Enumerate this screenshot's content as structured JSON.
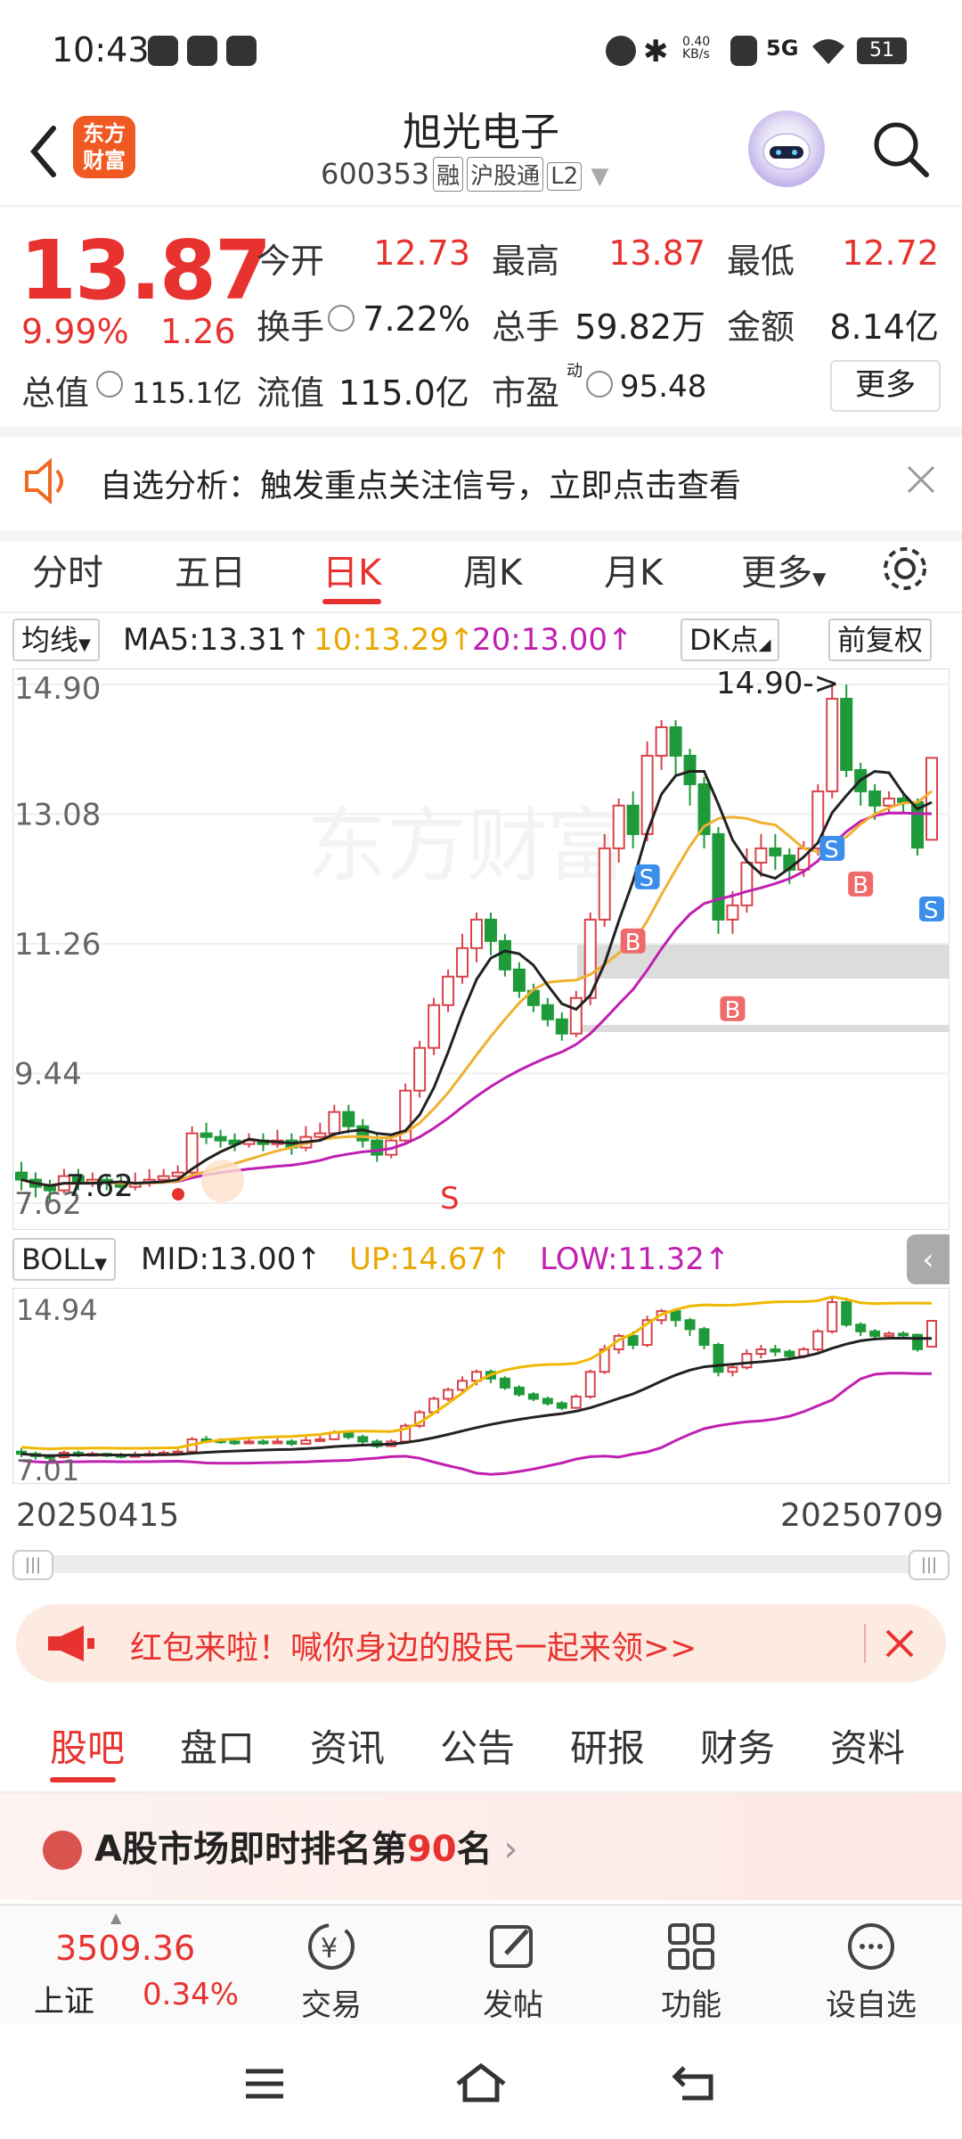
{
  "status_bar": {
    "time": "10:43",
    "speed": "0.40\nKB/s",
    "battery": "51"
  },
  "header": {
    "logo_text": "东方财富",
    "stock_name": "旭光电子",
    "stock_code": "600353",
    "tags": [
      "融",
      "沪股通",
      "L2"
    ]
  },
  "quote": {
    "price": "13.87",
    "change_pct": "9.99%",
    "change": "1.26",
    "stats": [
      {
        "label": "今开",
        "value": "12.73",
        "color": "#e8322f"
      },
      {
        "label": "最高",
        "value": "13.87",
        "color": "#e8322f"
      },
      {
        "label": "最低",
        "value": "12.72",
        "color": "#e8322f"
      },
      {
        "label": "换手",
        "value": "7.22%",
        "color": "#222222"
      },
      {
        "label": "总手",
        "value": "59.82万",
        "color": "#222222"
      },
      {
        "label": "金额",
        "value": "8.14亿",
        "color": "#222222"
      }
    ],
    "total_value_label": "总值",
    "total_value": "115.1亿",
    "float_value_label": "流值",
    "float_value": "115.0亿",
    "pe_label": "市盈",
    "pe_superscript": "动",
    "pe_value": "95.48",
    "more_label": "更多"
  },
  "alert": {
    "text": "自选分析：触发重点关注信号，立即点击查看"
  },
  "chart_tabs": {
    "items": [
      "分时",
      "五日",
      "日K",
      "周K",
      "月K",
      "更多"
    ],
    "active": "日K"
  },
  "indicator_bar": {
    "selector": "均线",
    "ma5": "MA5:13.31↑",
    "ma10": "10:13.29↑",
    "ma20": "20:13.00↑",
    "dk_label": "DK点",
    "adjust_label": "前复权"
  },
  "chart_data": [
    {
      "type": "candlestick",
      "y_ticks": [
        "14.90",
        "13.08",
        "11.26",
        "9.44",
        "7.62"
      ],
      "ylim": [
        7.62,
        14.9
      ],
      "max_marker": "14.90->",
      "min_marker": "7.62",
      "signal_markers": [
        "S",
        "B",
        "B",
        "S",
        "B",
        "S"
      ],
      "s_label_bottom": "S",
      "candles": [
        [
          8.05,
          7.95,
          8.2,
          7.8
        ],
        [
          7.95,
          7.85,
          8.05,
          7.7
        ],
        [
          7.85,
          7.8,
          7.95,
          7.62
        ],
        [
          7.8,
          8.0,
          8.1,
          7.75
        ],
        [
          8.0,
          7.9,
          8.1,
          7.8
        ],
        [
          7.9,
          7.95,
          8.05,
          7.85
        ],
        [
          7.95,
          7.9,
          8.0,
          7.8
        ],
        [
          7.9,
          7.85,
          8.0,
          7.75
        ],
        [
          7.85,
          7.9,
          8.05,
          7.8
        ],
        [
          7.9,
          7.95,
          8.1,
          7.85
        ],
        [
          7.95,
          8.0,
          8.1,
          7.9
        ],
        [
          8.0,
          8.05,
          8.15,
          7.95
        ],
        [
          8.05,
          8.6,
          8.7,
          8.0
        ],
        [
          8.6,
          8.55,
          8.75,
          8.45
        ],
        [
          8.55,
          8.5,
          8.65,
          8.4
        ],
        [
          8.5,
          8.45,
          8.6,
          8.35
        ],
        [
          8.45,
          8.5,
          8.6,
          8.4
        ],
        [
          8.5,
          8.45,
          8.6,
          8.35
        ],
        [
          8.45,
          8.5,
          8.65,
          8.4
        ],
        [
          8.5,
          8.4,
          8.6,
          8.3
        ],
        [
          8.4,
          8.55,
          8.7,
          8.35
        ],
        [
          8.55,
          8.6,
          8.75,
          8.5
        ],
        [
          8.6,
          8.9,
          9.0,
          8.55
        ],
        [
          8.9,
          8.7,
          9.0,
          8.6
        ],
        [
          8.7,
          8.5,
          8.8,
          8.4
        ],
        [
          8.5,
          8.3,
          8.6,
          8.2
        ],
        [
          8.3,
          8.5,
          8.6,
          8.25
        ],
        [
          8.5,
          9.2,
          9.3,
          8.45
        ],
        [
          9.2,
          9.8,
          9.9,
          9.1
        ],
        [
          9.8,
          10.4,
          10.5,
          9.7
        ],
        [
          10.4,
          10.8,
          10.9,
          10.3
        ],
        [
          10.8,
          11.2,
          11.4,
          10.7
        ],
        [
          11.2,
          11.6,
          11.7,
          11.0
        ],
        [
          11.6,
          11.3,
          11.7,
          11.1
        ],
        [
          11.3,
          10.9,
          11.4,
          10.8
        ],
        [
          10.9,
          10.6,
          11.0,
          10.5
        ],
        [
          10.6,
          10.4,
          10.7,
          10.3
        ],
        [
          10.4,
          10.2,
          10.5,
          10.1
        ],
        [
          10.2,
          10.0,
          10.3,
          9.9
        ],
        [
          10.0,
          10.5,
          10.6,
          9.95
        ],
        [
          10.5,
          11.6,
          11.7,
          10.4
        ],
        [
          11.6,
          12.6,
          12.8,
          11.5
        ],
        [
          12.6,
          13.2,
          13.3,
          12.4
        ],
        [
          13.2,
          12.8,
          13.4,
          12.6
        ],
        [
          12.8,
          13.9,
          14.1,
          12.7
        ],
        [
          13.9,
          14.3,
          14.4,
          13.7
        ],
        [
          14.3,
          13.9,
          14.4,
          13.6
        ],
        [
          13.9,
          13.5,
          14.0,
          13.2
        ],
        [
          13.5,
          12.8,
          13.6,
          12.6
        ],
        [
          12.8,
          11.6,
          12.9,
          11.4
        ],
        [
          11.6,
          11.8,
          12.0,
          11.4
        ],
        [
          11.8,
          12.4,
          12.6,
          11.7
        ],
        [
          12.4,
          12.6,
          12.8,
          12.2
        ],
        [
          12.6,
          12.5,
          12.8,
          12.3
        ],
        [
          12.5,
          12.3,
          12.6,
          12.1
        ],
        [
          12.3,
          12.6,
          12.7,
          12.2
        ],
        [
          12.6,
          13.4,
          13.5,
          12.5
        ],
        [
          13.4,
          14.7,
          14.9,
          13.3
        ],
        [
          14.7,
          13.7,
          14.9,
          13.6
        ],
        [
          13.7,
          13.4,
          13.8,
          13.2
        ],
        [
          13.4,
          13.2,
          13.5,
          13.0
        ],
        [
          13.2,
          13.3,
          13.4,
          13.1
        ],
        [
          13.3,
          13.25,
          13.4,
          13.1
        ],
        [
          13.25,
          12.61,
          13.3,
          12.5
        ],
        [
          12.72,
          13.87,
          13.87,
          12.72
        ]
      ]
    },
    {
      "type": "bollinger",
      "selector": "BOLL",
      "mid": "MID:13.00↑",
      "up": "UP:14.67↑",
      "low": "LOW:11.32↑",
      "y_ticks": [
        "14.94",
        "7.01"
      ],
      "ylim": [
        7.01,
        14.94
      ]
    }
  ],
  "dates": {
    "start": "20250415",
    "end": "20250709"
  },
  "banner": {
    "text": "红包来啦！喊你身边的股民一起来领>>"
  },
  "sub_tabs": {
    "items": [
      "股吧",
      "盘口",
      "资讯",
      "公告",
      "研报",
      "财务",
      "资料"
    ],
    "active": "股吧"
  },
  "rank": {
    "prefix": "A股市场即时排名第",
    "number": "90",
    "suffix": "名"
  },
  "bottom_nav": {
    "index_value": "3509.36",
    "index_name": "上证",
    "index_change": "0.34%",
    "items": [
      "交易",
      "发帖",
      "功能",
      "设自选"
    ]
  }
}
